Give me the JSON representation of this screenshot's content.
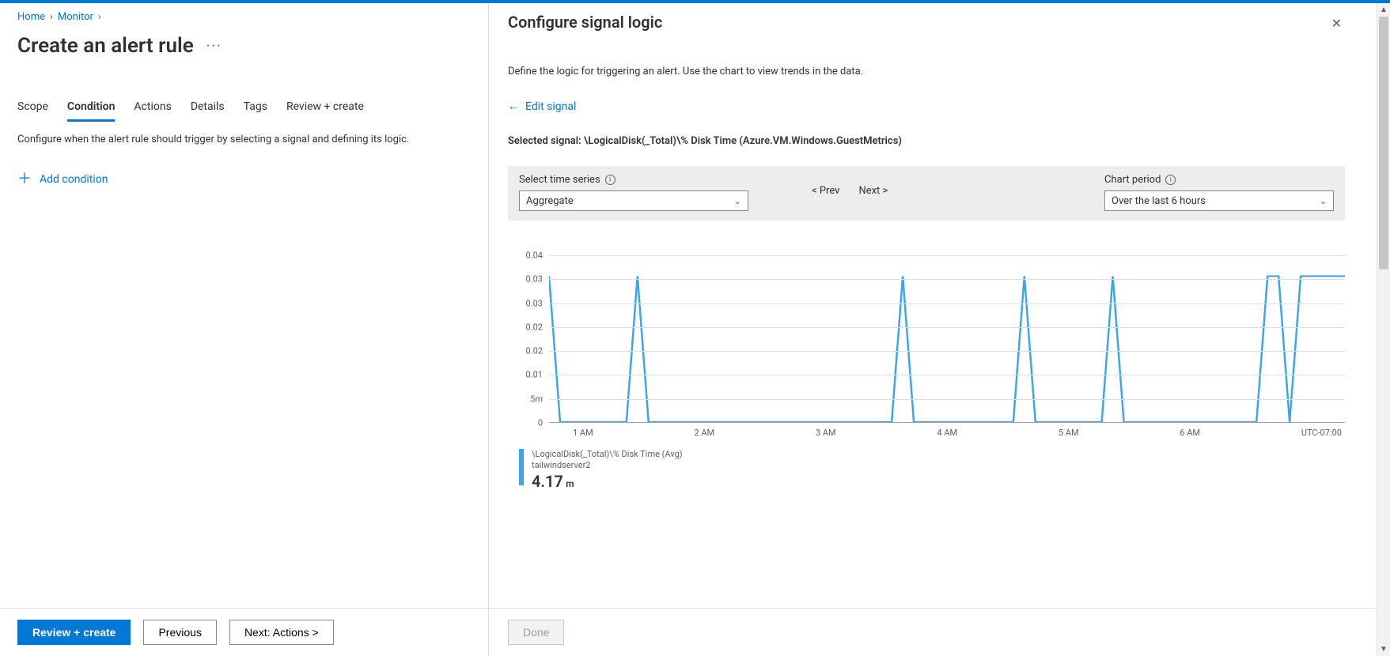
{
  "breadcrumb": {
    "home": "Home",
    "monitor": "Monitor"
  },
  "page_title": "Create an alert rule",
  "tabs": [
    "Scope",
    "Condition",
    "Actions",
    "Details",
    "Tags",
    "Review + create"
  ],
  "active_tab_index": 1,
  "left_desc": "Configure when the alert rule should trigger by selecting a signal and defining its logic.",
  "add_condition": "Add condition",
  "footer": {
    "review": "Review + create",
    "previous": "Previous",
    "next": "Next: Actions >"
  },
  "panel": {
    "title": "Configure signal logic",
    "subtitle": "Define the logic for triggering an alert. Use the chart to view trends in the data.",
    "edit_signal": "Edit signal",
    "selected_label": "Selected signal:",
    "selected_value": "\\LogicalDisk(_Total)\\% Disk Time (Azure.VM.Windows.GuestMetrics)",
    "time_series_label": "Select time series",
    "time_series_value": "Aggregate",
    "prev": "< Prev",
    "next": "Next >",
    "chart_period_label": "Chart period",
    "chart_period_value": "Over the last 6 hours",
    "done": "Done"
  },
  "chart_data": {
    "type": "line",
    "y_ticks": [
      "0.04",
      "0.03",
      "0.03",
      "0.02",
      "0.02",
      "0.01",
      "5m",
      "0"
    ],
    "x_labels": [
      "1 AM",
      "2 AM",
      "3 AM",
      "4 AM",
      "5 AM",
      "6 AM"
    ],
    "tz": "UTC-07:00",
    "x": [
      0,
      1,
      2,
      3,
      4,
      5,
      6,
      7,
      8,
      9,
      10,
      11,
      12,
      13,
      14,
      15,
      16,
      17,
      18,
      19,
      20,
      21,
      22,
      23,
      24,
      25,
      26,
      27,
      28,
      29,
      30,
      31,
      32,
      33,
      34,
      35,
      36,
      37,
      38,
      39,
      40,
      41,
      42,
      43,
      44,
      45,
      46,
      47,
      48,
      49,
      50,
      51,
      52,
      53,
      54,
      55,
      56,
      57,
      58,
      59,
      60,
      61,
      62,
      63,
      64,
      65,
      66,
      67,
      68,
      69,
      70,
      71,
      72
    ],
    "values": [
      0.035,
      0,
      0,
      0,
      0,
      0,
      0,
      0,
      0.035,
      0,
      0,
      0,
      0,
      0,
      0,
      0,
      0,
      0,
      0,
      0,
      0,
      0,
      0,
      0,
      0,
      0,
      0,
      0,
      0,
      0,
      0,
      0,
      0.035,
      0,
      0,
      0,
      0,
      0,
      0,
      0,
      0,
      0,
      0,
      0.035,
      0,
      0,
      0,
      0,
      0,
      0,
      0,
      0.035,
      0,
      0,
      0,
      0,
      0,
      0,
      0,
      0,
      0,
      0,
      0,
      0,
      0,
      0.035,
      0.035,
      0,
      0.035,
      0.035,
      0.035,
      0.035,
      0.035
    ],
    "ymax": 0.04,
    "legend_line1": "\\LogicalDisk(_Total)\\% Disk Time (Avg)",
    "legend_line2": "tailwindserver2",
    "legend_value": "4.17",
    "legend_unit": "m"
  }
}
